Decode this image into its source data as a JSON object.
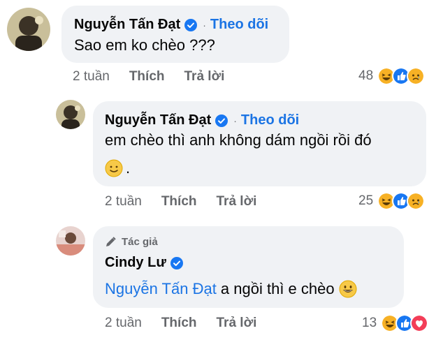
{
  "comments": [
    {
      "author": "Nguyễn Tấn Đạt",
      "follow": "Theo dõi",
      "dot": "·",
      "text": "Sao em ko chèo ???",
      "time": "2 tuần",
      "like": "Thích",
      "reply": "Trả lời",
      "reaction_count": "48",
      "reactions": [
        "haha",
        "like",
        "sad"
      ]
    },
    {
      "author": "Nguyễn Tấn Đạt",
      "follow": "Theo dõi",
      "dot": "·",
      "text_line1": "em chèo thì anh không dám ngồi rồi đó",
      "text_line2_suffix": ".",
      "time": "2 tuần",
      "like": "Thích",
      "reply": "Trả lời",
      "reaction_count": "25",
      "reactions": [
        "haha",
        "like",
        "sad"
      ]
    },
    {
      "author_badge": "Tác giả",
      "author": "Cindy Lư",
      "mention": "Nguyễn Tấn Đạt",
      "text_rest": " a ngồi thì e chèo",
      "time": "2 tuần",
      "like": "Thích",
      "reply": "Trả lời",
      "reaction_count": "13",
      "reactions": [
        "haha",
        "like",
        "love"
      ]
    }
  ],
  "colors": {
    "bubble": "#f0f2f5",
    "link": "#1b74e4",
    "meta": "#65676b",
    "like": "#1877f2",
    "haha": "#f7b125",
    "love": "#f33e58"
  }
}
